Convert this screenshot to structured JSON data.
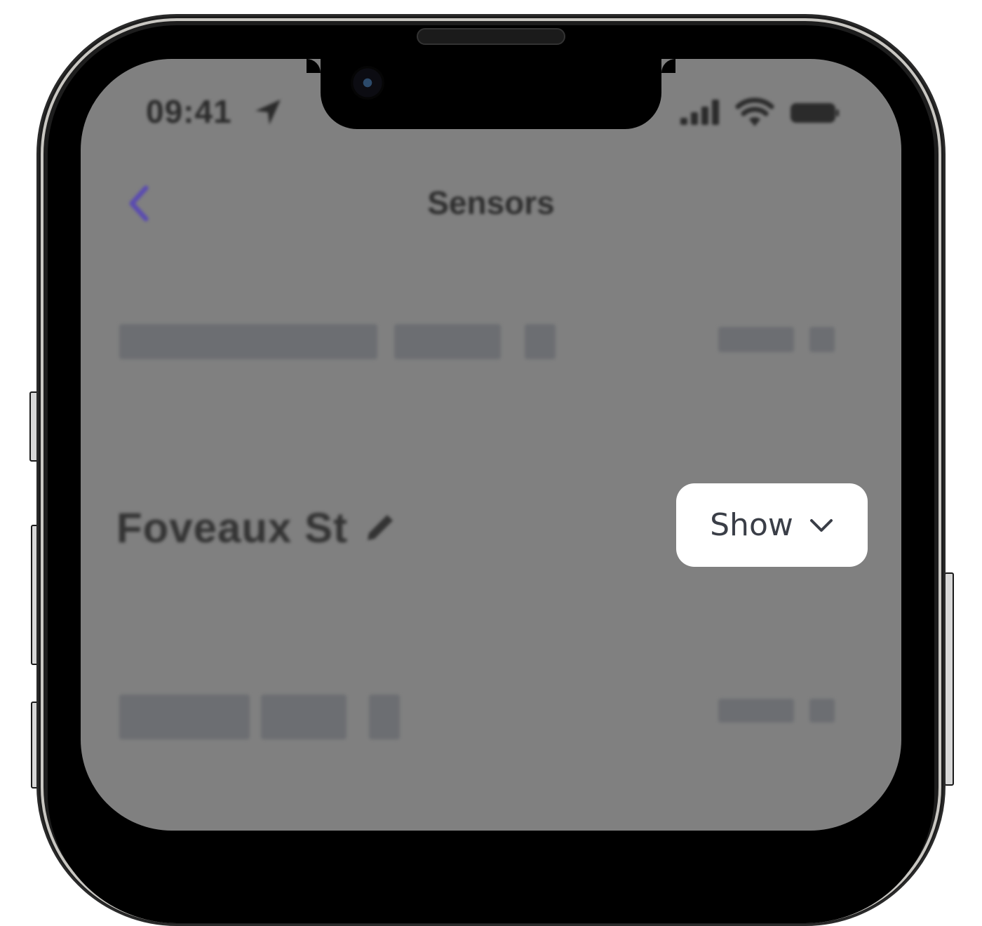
{
  "status_bar": {
    "time": "09:41",
    "icons": [
      "location-arrow-icon",
      "cellular-signal-icon",
      "wifi-icon",
      "battery-icon"
    ]
  },
  "nav": {
    "back_icon": "chevron-left-icon",
    "title": "Sensors"
  },
  "section": {
    "location_name": "Foveaux St",
    "edit_icon": "pencil-icon",
    "show_button": {
      "label": "Show",
      "icon": "chevron-down-icon"
    }
  },
  "colors": {
    "overlay": "#808080",
    "accent": "#5a4bb0",
    "button_bg": "#ffffff",
    "button_text": "#3a3e47",
    "skeleton": "#6c6e72"
  }
}
